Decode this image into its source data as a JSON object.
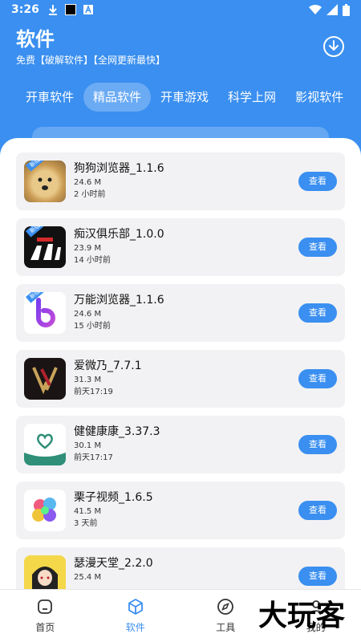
{
  "status_bar": {
    "time": "3:26"
  },
  "header": {
    "title": "软件",
    "subtitle": "免费【破解软件】【全网更新最快】"
  },
  "tabs": [
    {
      "label": "开車软件",
      "active": false
    },
    {
      "label": "精品软件",
      "active": true
    },
    {
      "label": "开車游戏",
      "active": false
    },
    {
      "label": "科学上网",
      "active": false
    },
    {
      "label": "影视软件",
      "active": false
    }
  ],
  "apps": [
    {
      "name": "狗狗浏览器_1.1.6",
      "size": "24.6 M",
      "time": "2 小时前",
      "tag": "新版本",
      "button": "查看",
      "icon": "doge-icon"
    },
    {
      "name": "痴汉俱乐部_1.0.0",
      "size": "23.9 M",
      "time": "14 小时前",
      "tag": "新版本",
      "button": "查看",
      "icon": "chihan-icon"
    },
    {
      "name": "万能浏览器_1.1.6",
      "size": "24.6 M",
      "time": "15 小时前",
      "tag": "新版本",
      "button": "查看",
      "icon": "browser-b-icon"
    },
    {
      "name": "爱微乃_7.7.1",
      "size": "31.3 M",
      "time": "前天17:19",
      "tag": "",
      "button": "查看",
      "icon": "aiweinai-icon"
    },
    {
      "name": "健健康康_3.37.3",
      "size": "30.1 M",
      "time": "前天17:17",
      "tag": "",
      "button": "查看",
      "icon": "heart-icon"
    },
    {
      "name": "栗子视频_1.6.5",
      "size": "41.5 M",
      "time": "3 天前",
      "tag": "",
      "button": "查看",
      "icon": "lizi-icon"
    },
    {
      "name": "瑟漫天堂_2.2.0",
      "size": "25.4 M",
      "time": "",
      "tag": "",
      "button": "查看",
      "icon": "anime-girl-icon"
    }
  ],
  "bottom_nav": [
    {
      "label": "首页",
      "icon": "home-icon",
      "active": false
    },
    {
      "label": "软件",
      "icon": "cube-icon",
      "active": true
    },
    {
      "label": "工具",
      "icon": "compass-icon",
      "active": false
    },
    {
      "label": "我的",
      "icon": "user-icon",
      "active": false
    }
  ],
  "watermark": "大玩客",
  "colors": {
    "primary": "#3a8ff0",
    "card_bg": "#f2f2f4"
  }
}
